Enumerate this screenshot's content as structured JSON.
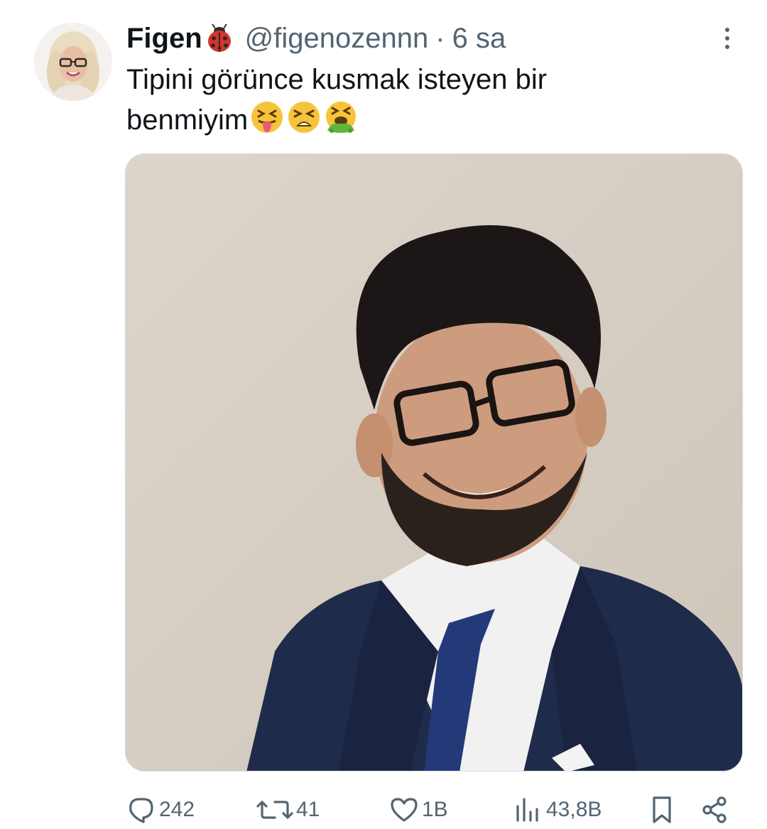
{
  "author": {
    "display_name": "Figen",
    "name_emoji": "ladybug",
    "handle": "@figenozennn",
    "separator": "·",
    "time": "6 sa"
  },
  "tweet": {
    "line1": "Tipini görünce kusmak isteyen bir",
    "line2": "benmiyim",
    "emojis": [
      "squinting-face-with-tongue",
      "tired-face",
      "face-vomiting"
    ]
  },
  "actions": {
    "replies": "242",
    "reposts": "41",
    "likes": "1B",
    "views": "43,8B"
  },
  "icons": {
    "reply": "reply-icon",
    "repost": "repost-icon",
    "like": "heart-icon",
    "views": "views-chart-icon",
    "bookmark": "bookmark-icon",
    "share": "share-icon",
    "more": "more-vertical-icon"
  },
  "colors": {
    "text": "#0f1419",
    "secondary": "#536471",
    "border": "#cfd9de",
    "background": "#ffffff"
  }
}
